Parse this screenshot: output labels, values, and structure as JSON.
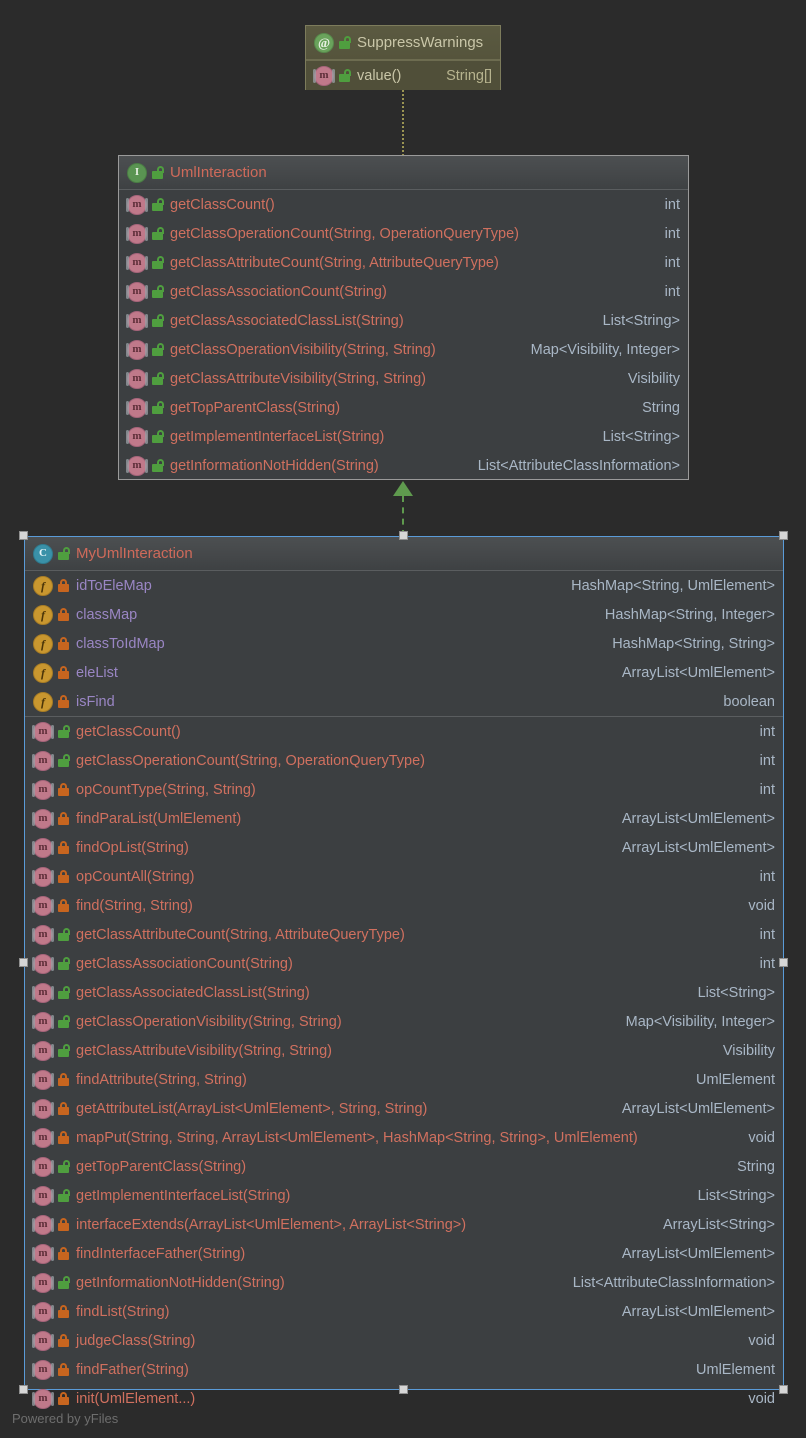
{
  "diagram": {
    "watermark": "Powered by yFiles",
    "colors": {
      "canvas_background": "#2b2b2b",
      "node_background": "#3c3f41",
      "annotation_background": "#504f39",
      "type_name": "#cf6a5a",
      "field_name": "#9a86c4",
      "return_type": "#a9b7c6",
      "selection_border": "#5a9bd8",
      "realization_edge": "#5f9a4e",
      "annotation_edge": "#9a9452"
    }
  },
  "nodes": {
    "annotation": {
      "icon": "annotation-icon",
      "visibility": "public",
      "name": "SuppressWarnings",
      "members": [
        {
          "icon": "method-icon",
          "visibility": "public",
          "name": "value()",
          "return_type": "String[]"
        }
      ]
    },
    "interface": {
      "icon": "interface-icon",
      "visibility": "public",
      "name": "UmlInteraction",
      "methods": [
        {
          "icon": "method-icon",
          "visibility": "public",
          "name": "getClassCount()",
          "return_type": "int"
        },
        {
          "icon": "method-icon",
          "visibility": "public",
          "name": "getClassOperationCount(String, OperationQueryType)",
          "return_type": "int"
        },
        {
          "icon": "method-icon",
          "visibility": "public",
          "name": "getClassAttributeCount(String, AttributeQueryType)",
          "return_type": "int"
        },
        {
          "icon": "method-icon",
          "visibility": "public",
          "name": "getClassAssociationCount(String)",
          "return_type": "int"
        },
        {
          "icon": "method-icon",
          "visibility": "public",
          "name": "getClassAssociatedClassList(String)",
          "return_type": "List<String>"
        },
        {
          "icon": "method-icon",
          "visibility": "public",
          "name": "getClassOperationVisibility(String, String)",
          "return_type": "Map<Visibility, Integer>"
        },
        {
          "icon": "method-icon",
          "visibility": "public",
          "name": "getClassAttributeVisibility(String, String)",
          "return_type": "Visibility"
        },
        {
          "icon": "method-icon",
          "visibility": "public",
          "name": "getTopParentClass(String)",
          "return_type": "String"
        },
        {
          "icon": "method-icon",
          "visibility": "public",
          "name": "getImplementInterfaceList(String)",
          "return_type": "List<String>"
        },
        {
          "icon": "method-icon",
          "visibility": "public",
          "name": "getInformationNotHidden(String)",
          "return_type": "List<AttributeClassInformation>"
        }
      ]
    },
    "class": {
      "icon": "class-icon",
      "visibility": "public",
      "name": "MyUmlInteraction",
      "selected": true,
      "fields": [
        {
          "icon": "field-icon",
          "visibility": "private",
          "name": "idToEleMap",
          "return_type": "HashMap<String, UmlElement>"
        },
        {
          "icon": "field-icon",
          "visibility": "private",
          "name": "classMap",
          "return_type": "HashMap<String, Integer>"
        },
        {
          "icon": "field-icon",
          "visibility": "private",
          "name": "classToIdMap",
          "return_type": "HashMap<String, String>"
        },
        {
          "icon": "field-icon",
          "visibility": "private",
          "name": "eleList",
          "return_type": "ArrayList<UmlElement>"
        },
        {
          "icon": "field-icon",
          "visibility": "private",
          "name": "isFind",
          "return_type": "boolean"
        }
      ],
      "methods": [
        {
          "icon": "method-icon",
          "visibility": "public",
          "name": "getClassCount()",
          "return_type": "int"
        },
        {
          "icon": "method-icon",
          "visibility": "public",
          "name": "getClassOperationCount(String, OperationQueryType)",
          "return_type": "int"
        },
        {
          "icon": "method-icon",
          "visibility": "private",
          "name": "opCountType(String, String)",
          "return_type": "int"
        },
        {
          "icon": "method-icon",
          "visibility": "private",
          "name": "findParaList(UmlElement)",
          "return_type": "ArrayList<UmlElement>"
        },
        {
          "icon": "method-icon",
          "visibility": "private",
          "name": "findOpList(String)",
          "return_type": "ArrayList<UmlElement>"
        },
        {
          "icon": "method-icon",
          "visibility": "private",
          "name": "opCountAll(String)",
          "return_type": "int"
        },
        {
          "icon": "method-icon",
          "visibility": "private",
          "name": "find(String, String)",
          "return_type": "void"
        },
        {
          "icon": "method-icon",
          "visibility": "public",
          "name": "getClassAttributeCount(String, AttributeQueryType)",
          "return_type": "int"
        },
        {
          "icon": "method-icon",
          "visibility": "public",
          "name": "getClassAssociationCount(String)",
          "return_type": "int"
        },
        {
          "icon": "method-icon",
          "visibility": "public",
          "name": "getClassAssociatedClassList(String)",
          "return_type": "List<String>"
        },
        {
          "icon": "method-icon",
          "visibility": "public",
          "name": "getClassOperationVisibility(String, String)",
          "return_type": "Map<Visibility, Integer>"
        },
        {
          "icon": "method-icon",
          "visibility": "public",
          "name": "getClassAttributeVisibility(String, String)",
          "return_type": "Visibility"
        },
        {
          "icon": "method-icon",
          "visibility": "private",
          "name": "findAttribute(String, String)",
          "return_type": "UmlElement"
        },
        {
          "icon": "method-icon",
          "visibility": "private",
          "name": "getAttributeList(ArrayList<UmlElement>, String, String)",
          "return_type": "ArrayList<UmlElement>"
        },
        {
          "icon": "method-icon",
          "visibility": "private",
          "name": "mapPut(String, String, ArrayList<UmlElement>, HashMap<String, String>, UmlElement)",
          "return_type": "void"
        },
        {
          "icon": "method-icon",
          "visibility": "public",
          "name": "getTopParentClass(String)",
          "return_type": "String"
        },
        {
          "icon": "method-icon",
          "visibility": "public",
          "name": "getImplementInterfaceList(String)",
          "return_type": "List<String>"
        },
        {
          "icon": "method-icon",
          "visibility": "private",
          "name": "interfaceExtends(ArrayList<UmlElement>, ArrayList<String>)",
          "return_type": "ArrayList<String>"
        },
        {
          "icon": "method-icon",
          "visibility": "private",
          "name": "findInterfaceFather(String)",
          "return_type": "ArrayList<UmlElement>"
        },
        {
          "icon": "method-icon",
          "visibility": "public",
          "name": "getInformationNotHidden(String)",
          "return_type": "List<AttributeClassInformation>"
        },
        {
          "icon": "method-icon",
          "visibility": "private",
          "name": "findList(String)",
          "return_type": "ArrayList<UmlElement>"
        },
        {
          "icon": "method-icon",
          "visibility": "private",
          "name": "judgeClass(String)",
          "return_type": "void"
        },
        {
          "icon": "method-icon",
          "visibility": "private",
          "name": "findFather(String)",
          "return_type": "UmlElement"
        },
        {
          "icon": "method-icon",
          "visibility": "private",
          "name": "init(UmlElement...)",
          "return_type": "void"
        }
      ]
    }
  },
  "edges": [
    {
      "name": "annotation-link",
      "style": "dotted",
      "from": "annotation",
      "to": "interface"
    },
    {
      "name": "realization-link",
      "style": "dashed-with-triangle",
      "from": "class",
      "to": "interface"
    }
  ],
  "icon_glyphs": {
    "interface-icon": "I",
    "class-icon": "C",
    "annotation-icon": "@",
    "method-icon": "m",
    "field-icon": "f"
  }
}
